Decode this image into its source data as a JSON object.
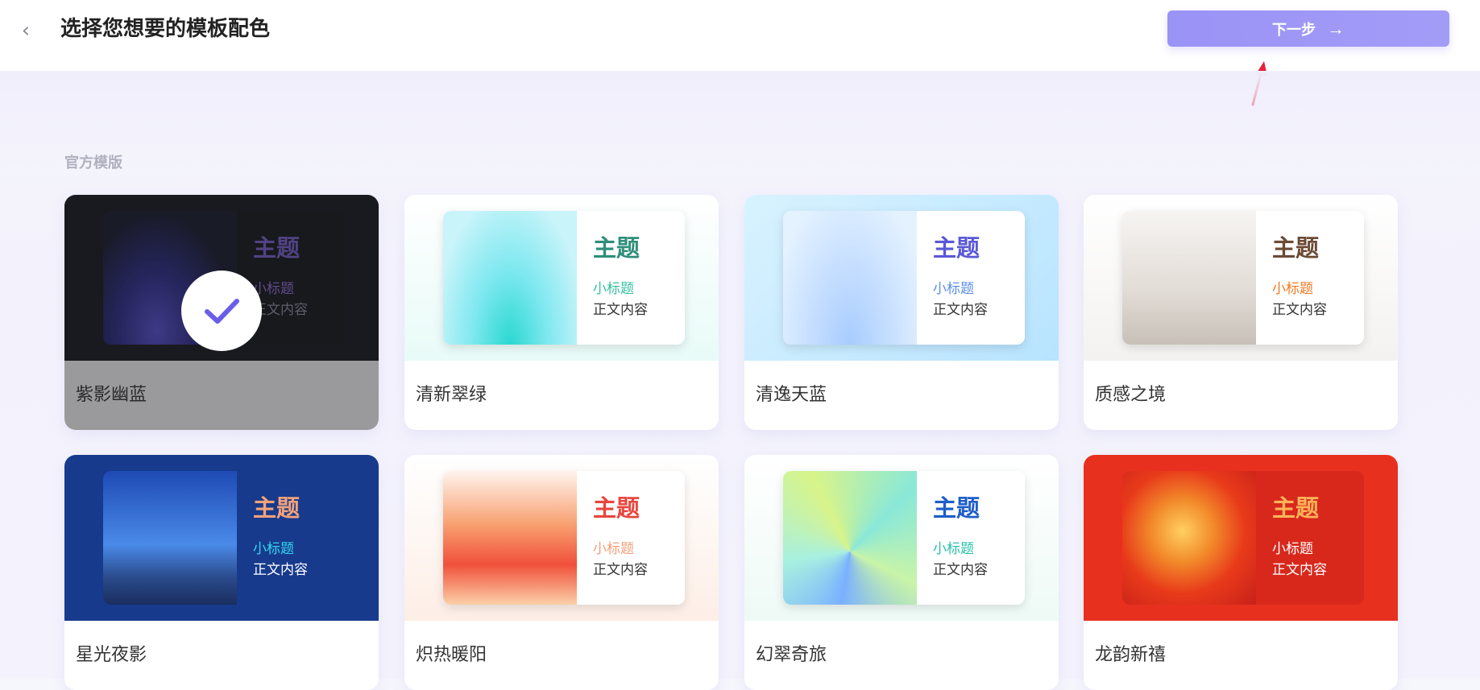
{
  "header": {
    "back_icon": "chevron-left-icon",
    "title": "选择您想要的模板配色",
    "next_label": "下一步",
    "next_arrow": "→"
  },
  "colors": {
    "accent": "#9a93f6",
    "annotation": "#e8203a"
  },
  "section_label": "官方模版",
  "templates": [
    {
      "name": "紫影幽蓝",
      "title": "主题",
      "subtitle": "小标题",
      "body": "正文内容",
      "selected": true,
      "title_color": "#7a5fd4",
      "subtitle_color": "#9a6fe0",
      "panel_bg": "#121418"
    },
    {
      "name": "清新翠绿",
      "title": "主题",
      "subtitle": "小标题",
      "body": "正文内容",
      "selected": false,
      "title_color": "#2e8e7a",
      "subtitle_color": "#36c0a0",
      "panel_bg": "#ffffff"
    },
    {
      "name": "清逸天蓝",
      "title": "主题",
      "subtitle": "小标题",
      "body": "正文内容",
      "selected": false,
      "title_color": "#5a58d6",
      "subtitle_color": "#5a8ee6",
      "panel_bg": "#ffffff"
    },
    {
      "name": "质感之境",
      "title": "主题",
      "subtitle": "小标题",
      "body": "正文内容",
      "selected": false,
      "title_color": "#6b4a34",
      "subtitle_color": "#f07a26",
      "panel_bg": "#ffffff"
    },
    {
      "name": "星光夜影",
      "title": "主题",
      "subtitle": "小标题",
      "body": "正文内容",
      "selected": false,
      "title_color": "#f4a27a",
      "subtitle_color": "#34d6f0",
      "panel_bg": "#173a8c"
    },
    {
      "name": "炽热暖阳",
      "title": "主题",
      "subtitle": "小标题",
      "body": "正文内容",
      "selected": false,
      "title_color": "#e8463e",
      "subtitle_color": "#f2a07a",
      "panel_bg": "#ffffff"
    },
    {
      "name": "幻翠奇旅",
      "title": "主题",
      "subtitle": "小标题",
      "body": "正文内容",
      "selected": false,
      "title_color": "#1e5ec8",
      "subtitle_color": "#2ac0a8",
      "panel_bg": "#ffffff"
    },
    {
      "name": "龙韵新禧",
      "title": "主题",
      "subtitle": "小标题",
      "body": "正文内容",
      "selected": false,
      "title_color": "#ffb45a",
      "subtitle_color": "#ffffff",
      "panel_bg": "#d8281c"
    }
  ]
}
